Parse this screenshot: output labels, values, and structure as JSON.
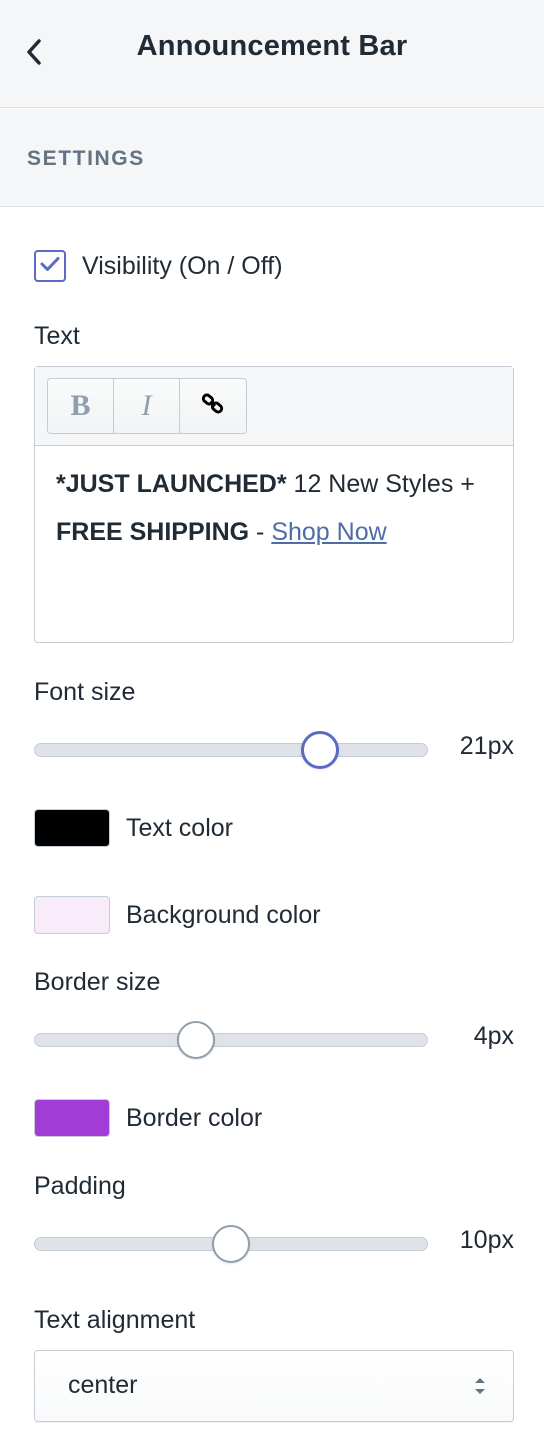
{
  "header": {
    "title": "Announcement Bar",
    "back_icon": "chevron-left-icon"
  },
  "section": {
    "title": "SETTINGS"
  },
  "visibility": {
    "label": "Visibility (On / Off)",
    "checked": true
  },
  "text_field": {
    "label": "Text",
    "toolbar": {
      "bold_label": "B",
      "italic_label": "I",
      "link_icon": "link-icon"
    },
    "content": {
      "bold_1": "*JUST LAUNCHED*",
      "plain_1": " 12 New Styles + ",
      "bold_2": "FREE SHIPPING",
      "plain_2": " - ",
      "link_text": "Shop Now"
    }
  },
  "font_size": {
    "label": "Font size",
    "value_text": "21px",
    "fraction": 0.725
  },
  "text_color": {
    "label": "Text color",
    "color": "#000000"
  },
  "background_color": {
    "label": "Background color",
    "color": "#f8ecfb"
  },
  "border_size": {
    "label": "Border size",
    "value_text": "4px",
    "fraction": 0.41
  },
  "border_color": {
    "label": "Border color",
    "color": "#a23cd6"
  },
  "padding": {
    "label": "Padding",
    "value_text": "10px",
    "fraction": 0.5
  },
  "text_alignment": {
    "label": "Text alignment",
    "selected": "center"
  },
  "colors": {
    "accent": "#5c6ac4",
    "link": "#4e6da8",
    "panel_bg": "#f4f6f8",
    "muted_text": "#637381"
  }
}
